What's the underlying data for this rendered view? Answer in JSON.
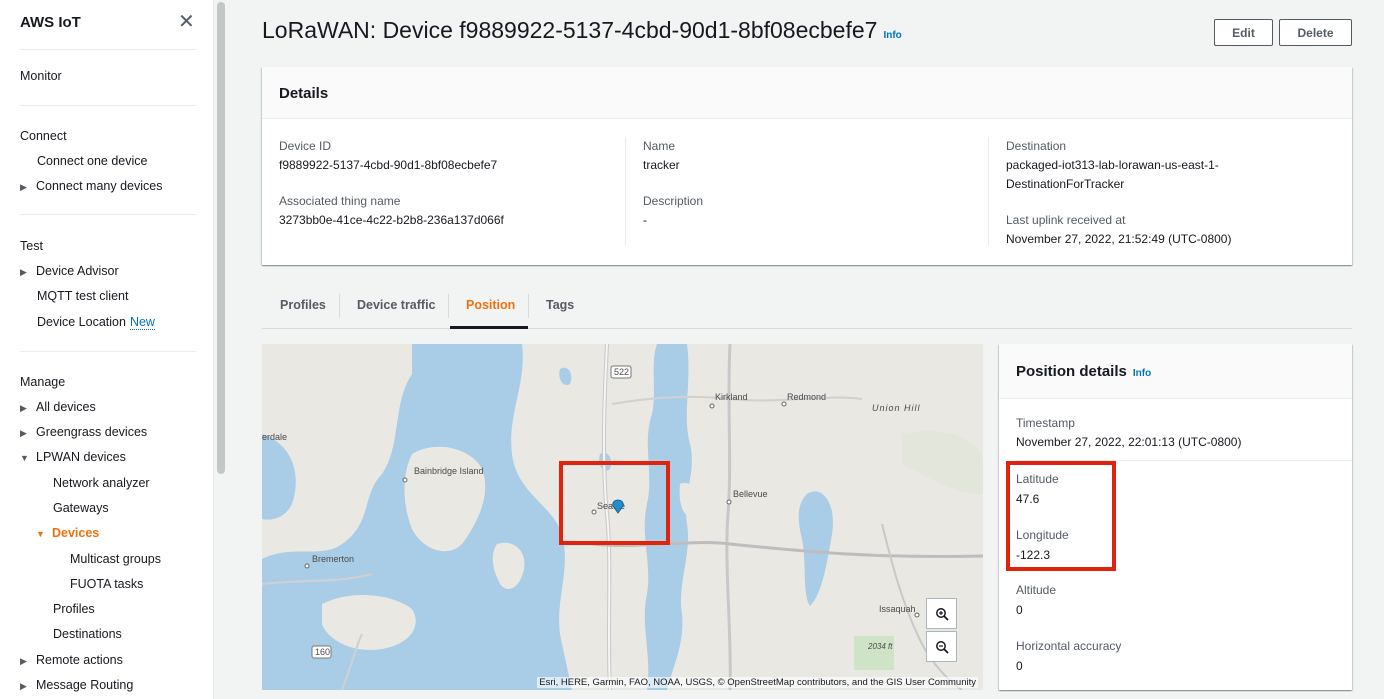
{
  "sidebar": {
    "title": "AWS IoT",
    "close_icon": "close-icon",
    "monitor": "Monitor",
    "connect": {
      "heading": "Connect",
      "connect_one": "Connect one device",
      "connect_many": "Connect many devices"
    },
    "test": {
      "heading": "Test",
      "device_advisor": "Device Advisor",
      "mqtt": "MQTT test client",
      "device_location": "Device Location",
      "new_badge": "New"
    },
    "manage": {
      "heading": "Manage",
      "all_devices": "All devices",
      "greengrass": "Greengrass devices",
      "lpwan": "LPWAN devices",
      "network_analyzer": "Network analyzer",
      "gateways": "Gateways",
      "devices": "Devices",
      "multicast": "Multicast groups",
      "fuota": "FUOTA tasks",
      "profiles": "Profiles",
      "destinations": "Destinations",
      "remote_actions": "Remote actions",
      "message_routing": "Message Routing"
    }
  },
  "header": {
    "title": "LoRaWAN: Device f9889922-5137-4cbd-90d1-8bf08ecbefe7",
    "info": "Info",
    "edit": "Edit",
    "delete": "Delete"
  },
  "details": {
    "heading": "Details",
    "device_id_label": "Device ID",
    "device_id": "f9889922-5137-4cbd-90d1-8bf08ecbefe7",
    "thing_label": "Associated thing name",
    "thing": "3273bb0e-41ce-4c22-b2b8-236a137d066f",
    "name_label": "Name",
    "name": "tracker",
    "description_label": "Description",
    "description": "-",
    "destination_label": "Destination",
    "destination_line1": "packaged-iot313-lab-lorawan-us-east-1-",
    "destination_line2": "DestinationForTracker",
    "uplink_label": "Last uplink received at",
    "uplink": "November 27, 2022, 21:52:49 (UTC-0800)"
  },
  "tabs": [
    "Profiles",
    "Device traffic",
    "Position",
    "Tags"
  ],
  "active_tab": "Position",
  "map": {
    "labels": {
      "seattle": "Seattle",
      "bainbridge": "Bainbridge Island",
      "bremerton": "Bremerton",
      "kirkland": "Kirkland",
      "redmond": "Redmond",
      "bellevue": "Bellevue",
      "union_hill": "Union Hill",
      "issaquah": "Issaquah",
      "erdale": "erdale",
      "route_522": "522",
      "route_160": "160",
      "elevation": "2034 ft"
    },
    "attribution": "Esri, HERE, Garmin, FAO, NOAA, USGS, © OpenStreetMap contributors, and the GIS User Community",
    "zoom_in_icon": "zoom-in-icon",
    "zoom_out_icon": "zoom-out-icon",
    "marker_icon": "location-marker-icon",
    "highlight_color": "#e0230e"
  },
  "position": {
    "heading": "Position details",
    "info": "Info",
    "timestamp_label": "Timestamp",
    "timestamp": "November 27, 2022, 22:01:13 (UTC-0800)",
    "latitude_label": "Latitude",
    "latitude": "47.6",
    "longitude_label": "Longitude",
    "longitude": "-122.3",
    "altitude_label": "Altitude",
    "altitude": "0",
    "accuracy_label": "Horizontal accuracy",
    "accuracy": "0"
  },
  "colors": {
    "accent": "#ec7211",
    "link": "#0073bb",
    "water": "#a9cde6",
    "land": "#e9e8e3"
  }
}
